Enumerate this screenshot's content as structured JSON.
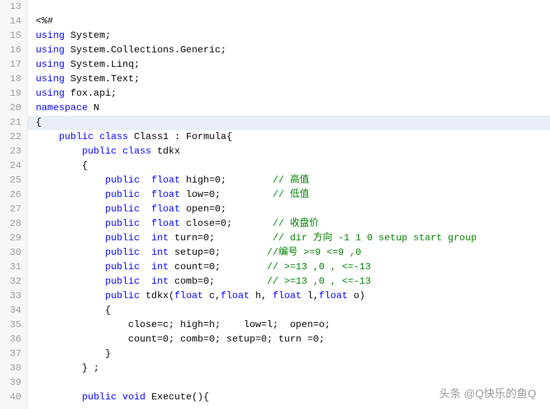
{
  "editor": {
    "startLine": 13,
    "highlightedLineIndex": 8,
    "lines": [
      "",
      "<%#",
      "using System;",
      "using System.Collections.Generic;",
      "using System.Linq;",
      "using System.Text;",
      "using fox.api;",
      "namespace N",
      "{",
      "    public class Class1 : Formula{",
      "        public class tdkx",
      "        {",
      "            public  float high=0;        // 高值",
      "            public  float low=0;         // 低值",
      "            public  float open=0;",
      "            public  float close=0;       // 收盘价",
      "            public  int turn=0;          // dir 方向 -1 1 0 setup start group",
      "            public  int setup=0;        //编号 >=9 <=9 ,0",
      "            public  int count=0;        // >=13 ,0 , <=-13",
      "            public  int comb=0;         // >=13 ,0 , <=-13",
      "            public tdkx(float c,float h, float l,float o)",
      "            {",
      "                close=c; high=h;    low=l;  open=o;",
      "                count=0; comb=0; setup=0; turn =0;",
      "            }",
      "        } ;",
      "",
      "        public void Execute(){"
    ]
  },
  "watermark": "头条 @Q快乐的鱼Q"
}
